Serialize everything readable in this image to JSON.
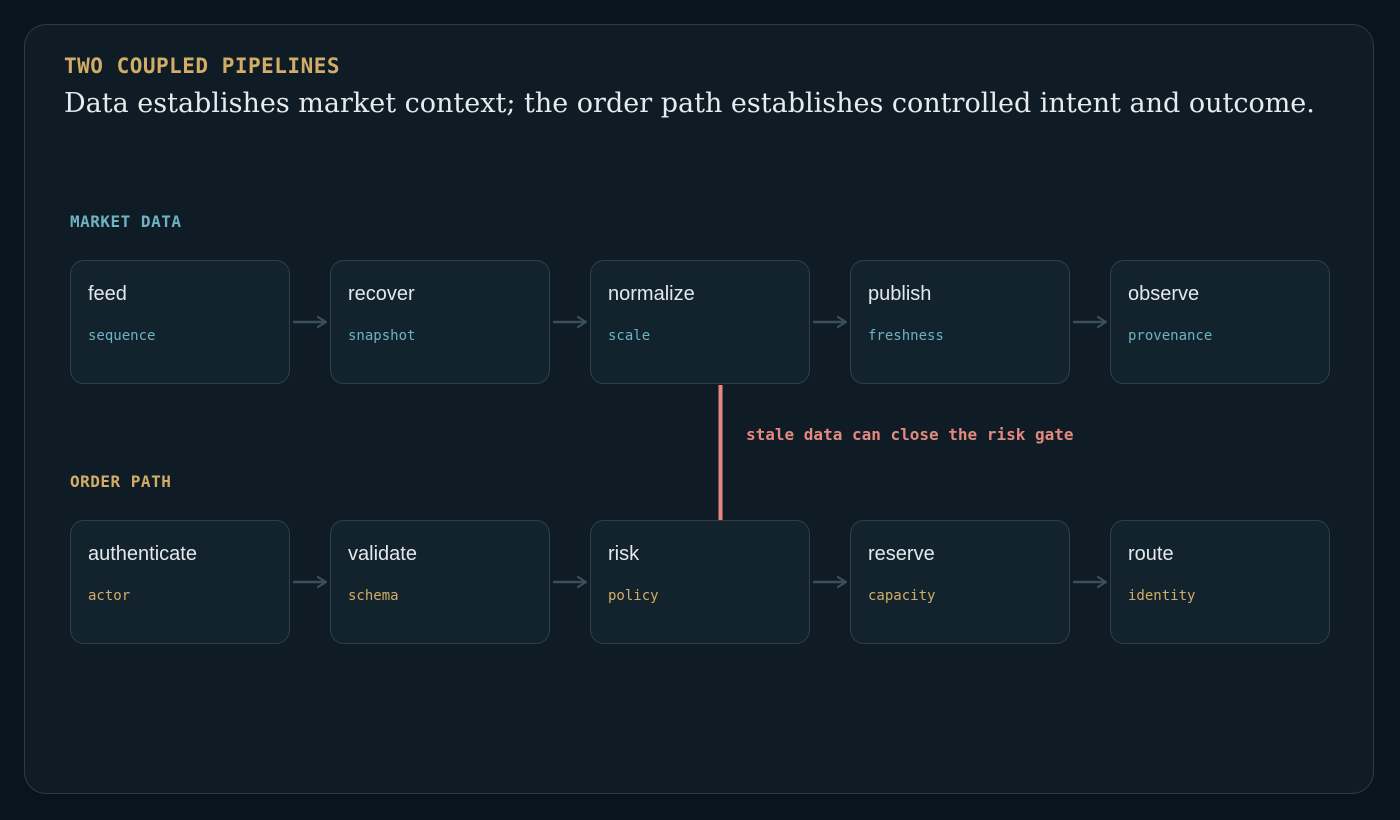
{
  "header": {
    "eyebrow": "TWO COUPLED PIPELINES",
    "headline": "Data establishes market context; the order path establishes controlled intent and outcome."
  },
  "market_data": {
    "label": "MARKET DATA",
    "stages": [
      {
        "name": "feed",
        "detail": "sequence"
      },
      {
        "name": "recover",
        "detail": "snapshot"
      },
      {
        "name": "normalize",
        "detail": "scale"
      },
      {
        "name": "publish",
        "detail": "freshness"
      },
      {
        "name": "observe",
        "detail": "provenance"
      }
    ]
  },
  "order_path": {
    "label": "ORDER PATH",
    "stages": [
      {
        "name": "authenticate",
        "detail": "actor"
      },
      {
        "name": "validate",
        "detail": "schema"
      },
      {
        "name": "risk",
        "detail": "policy"
      },
      {
        "name": "reserve",
        "detail": "capacity"
      },
      {
        "name": "route",
        "detail": "identity"
      }
    ]
  },
  "coupling": {
    "label": "stale data can close the risk gate",
    "from": "normalize",
    "to": "risk"
  },
  "colors": {
    "background": "#0a141d",
    "panel": "#0f1c26",
    "data_accent": "#6fb2c2",
    "order_accent": "#d2ad66",
    "coupling_accent": "#e58980",
    "arrow": "#3a4f5a"
  }
}
